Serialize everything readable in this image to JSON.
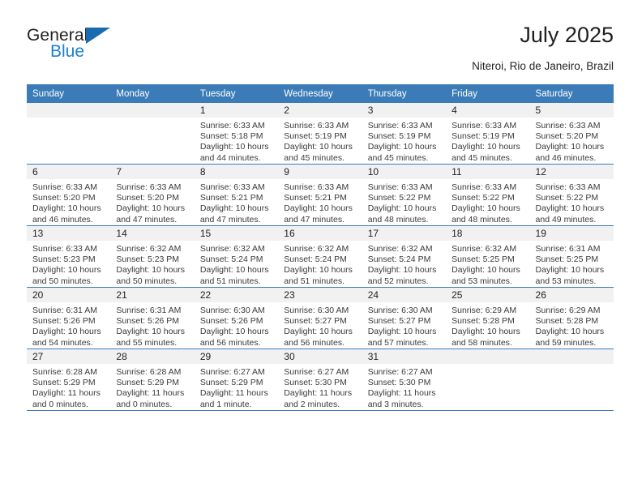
{
  "brand": {
    "name_part1": "General",
    "name_part2": "Blue",
    "triangle_icon": "blue-triangle-logo-mark",
    "colors": {
      "dark": "#231f20",
      "blue": "#1a7fd4",
      "triangle": "#1a6bb0"
    }
  },
  "header": {
    "title": "July 2025",
    "location": "Niteroi, Rio de Janeiro, Brazil"
  },
  "calendar": {
    "accent_color": "#3b7cb8",
    "band_color": "#f1f1f1",
    "weekday_headers": [
      "Sunday",
      "Monday",
      "Tuesday",
      "Wednesday",
      "Thursday",
      "Friday",
      "Saturday"
    ],
    "weeks": [
      [
        {
          "day": "",
          "lines": []
        },
        {
          "day": "",
          "lines": []
        },
        {
          "day": "1",
          "lines": [
            "Sunrise: 6:33 AM",
            "Sunset: 5:18 PM",
            "Daylight: 10 hours",
            "and 44 minutes."
          ]
        },
        {
          "day": "2",
          "lines": [
            "Sunrise: 6:33 AM",
            "Sunset: 5:19 PM",
            "Daylight: 10 hours",
            "and 45 minutes."
          ]
        },
        {
          "day": "3",
          "lines": [
            "Sunrise: 6:33 AM",
            "Sunset: 5:19 PM",
            "Daylight: 10 hours",
            "and 45 minutes."
          ]
        },
        {
          "day": "4",
          "lines": [
            "Sunrise: 6:33 AM",
            "Sunset: 5:19 PM",
            "Daylight: 10 hours",
            "and 45 minutes."
          ]
        },
        {
          "day": "5",
          "lines": [
            "Sunrise: 6:33 AM",
            "Sunset: 5:20 PM",
            "Daylight: 10 hours",
            "and 46 minutes."
          ]
        }
      ],
      [
        {
          "day": "6",
          "lines": [
            "Sunrise: 6:33 AM",
            "Sunset: 5:20 PM",
            "Daylight: 10 hours",
            "and 46 minutes."
          ]
        },
        {
          "day": "7",
          "lines": [
            "Sunrise: 6:33 AM",
            "Sunset: 5:20 PM",
            "Daylight: 10 hours",
            "and 47 minutes."
          ]
        },
        {
          "day": "8",
          "lines": [
            "Sunrise: 6:33 AM",
            "Sunset: 5:21 PM",
            "Daylight: 10 hours",
            "and 47 minutes."
          ]
        },
        {
          "day": "9",
          "lines": [
            "Sunrise: 6:33 AM",
            "Sunset: 5:21 PM",
            "Daylight: 10 hours",
            "and 47 minutes."
          ]
        },
        {
          "day": "10",
          "lines": [
            "Sunrise: 6:33 AM",
            "Sunset: 5:22 PM",
            "Daylight: 10 hours",
            "and 48 minutes."
          ]
        },
        {
          "day": "11",
          "lines": [
            "Sunrise: 6:33 AM",
            "Sunset: 5:22 PM",
            "Daylight: 10 hours",
            "and 48 minutes."
          ]
        },
        {
          "day": "12",
          "lines": [
            "Sunrise: 6:33 AM",
            "Sunset: 5:22 PM",
            "Daylight: 10 hours",
            "and 49 minutes."
          ]
        }
      ],
      [
        {
          "day": "13",
          "lines": [
            "Sunrise: 6:33 AM",
            "Sunset: 5:23 PM",
            "Daylight: 10 hours",
            "and 50 minutes."
          ]
        },
        {
          "day": "14",
          "lines": [
            "Sunrise: 6:32 AM",
            "Sunset: 5:23 PM",
            "Daylight: 10 hours",
            "and 50 minutes."
          ]
        },
        {
          "day": "15",
          "lines": [
            "Sunrise: 6:32 AM",
            "Sunset: 5:24 PM",
            "Daylight: 10 hours",
            "and 51 minutes."
          ]
        },
        {
          "day": "16",
          "lines": [
            "Sunrise: 6:32 AM",
            "Sunset: 5:24 PM",
            "Daylight: 10 hours",
            "and 51 minutes."
          ]
        },
        {
          "day": "17",
          "lines": [
            "Sunrise: 6:32 AM",
            "Sunset: 5:24 PM",
            "Daylight: 10 hours",
            "and 52 minutes."
          ]
        },
        {
          "day": "18",
          "lines": [
            "Sunrise: 6:32 AM",
            "Sunset: 5:25 PM",
            "Daylight: 10 hours",
            "and 53 minutes."
          ]
        },
        {
          "day": "19",
          "lines": [
            "Sunrise: 6:31 AM",
            "Sunset: 5:25 PM",
            "Daylight: 10 hours",
            "and 53 minutes."
          ]
        }
      ],
      [
        {
          "day": "20",
          "lines": [
            "Sunrise: 6:31 AM",
            "Sunset: 5:26 PM",
            "Daylight: 10 hours",
            "and 54 minutes."
          ]
        },
        {
          "day": "21",
          "lines": [
            "Sunrise: 6:31 AM",
            "Sunset: 5:26 PM",
            "Daylight: 10 hours",
            "and 55 minutes."
          ]
        },
        {
          "day": "22",
          "lines": [
            "Sunrise: 6:30 AM",
            "Sunset: 5:26 PM",
            "Daylight: 10 hours",
            "and 56 minutes."
          ]
        },
        {
          "day": "23",
          "lines": [
            "Sunrise: 6:30 AM",
            "Sunset: 5:27 PM",
            "Daylight: 10 hours",
            "and 56 minutes."
          ]
        },
        {
          "day": "24",
          "lines": [
            "Sunrise: 6:30 AM",
            "Sunset: 5:27 PM",
            "Daylight: 10 hours",
            "and 57 minutes."
          ]
        },
        {
          "day": "25",
          "lines": [
            "Sunrise: 6:29 AM",
            "Sunset: 5:28 PM",
            "Daylight: 10 hours",
            "and 58 minutes."
          ]
        },
        {
          "day": "26",
          "lines": [
            "Sunrise: 6:29 AM",
            "Sunset: 5:28 PM",
            "Daylight: 10 hours",
            "and 59 minutes."
          ]
        }
      ],
      [
        {
          "day": "27",
          "lines": [
            "Sunrise: 6:28 AM",
            "Sunset: 5:29 PM",
            "Daylight: 11 hours",
            "and 0 minutes."
          ]
        },
        {
          "day": "28",
          "lines": [
            "Sunrise: 6:28 AM",
            "Sunset: 5:29 PM",
            "Daylight: 11 hours",
            "and 0 minutes."
          ]
        },
        {
          "day": "29",
          "lines": [
            "Sunrise: 6:27 AM",
            "Sunset: 5:29 PM",
            "Daylight: 11 hours",
            "and 1 minute."
          ]
        },
        {
          "day": "30",
          "lines": [
            "Sunrise: 6:27 AM",
            "Sunset: 5:30 PM",
            "Daylight: 11 hours",
            "and 2 minutes."
          ]
        },
        {
          "day": "31",
          "lines": [
            "Sunrise: 6:27 AM",
            "Sunset: 5:30 PM",
            "Daylight: 11 hours",
            "and 3 minutes."
          ]
        },
        {
          "day": "",
          "lines": []
        },
        {
          "day": "",
          "lines": []
        }
      ]
    ]
  }
}
